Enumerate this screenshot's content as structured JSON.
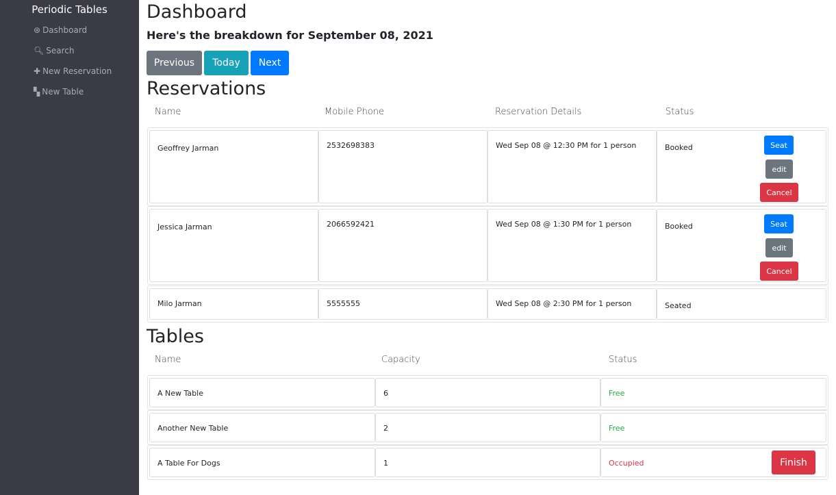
{
  "sidebar": {
    "brand": "Periodic Tables",
    "items": [
      {
        "label": "Dashboard",
        "icon": "dashboard-icon"
      },
      {
        "label": "Search",
        "icon": "search-icon"
      },
      {
        "label": "New Reservation",
        "icon": "plus-icon"
      },
      {
        "label": "New Table",
        "icon": "table-icon"
      }
    ]
  },
  "header": {
    "title": "Dashboard",
    "subtitle": "Here's the breakdown for September 08, 2021"
  },
  "nav_buttons": {
    "previous": "Previous",
    "today": "Today",
    "next": "Next"
  },
  "reservations": {
    "title": "Reservations",
    "columns": [
      "Name",
      "Mobile Phone",
      "Reservation Details",
      "Status"
    ],
    "rows": [
      {
        "name": "Geoffrey Jarman",
        "phone": "2532698383",
        "details": "Wed Sep 08 @ 12:30 PM for 1 person",
        "status": "Booked",
        "seat": "Seat",
        "edit": "edit",
        "cancel": "Cancel"
      },
      {
        "name": "Jessica Jarman",
        "phone": "2066592421",
        "details": "Wed Sep 08 @ 1:30 PM for 1 person",
        "status": "Booked",
        "seat": "Seat",
        "edit": "edit",
        "cancel": "Cancel"
      },
      {
        "name": "Milo Jarman",
        "phone": "5555555",
        "details": "Wed Sep 08 @ 2:30 PM for 1 person",
        "status": "Seated"
      }
    ]
  },
  "tables": {
    "title": "Tables",
    "columns": [
      "Name",
      "Capacity",
      "Status"
    ],
    "rows": [
      {
        "name": "A New Table",
        "capacity": "6",
        "status": "Free"
      },
      {
        "name": "Another New Table",
        "capacity": "2",
        "status": "Free"
      },
      {
        "name": "A Table For Dogs",
        "capacity": "1",
        "status": "Occupied",
        "finish": "Finish"
      }
    ]
  },
  "colors": {
    "free": "#28a745",
    "occupied": "#dc3545",
    "primary": "#007bff",
    "secondary": "#6c757d",
    "info": "#17a2b8"
  }
}
